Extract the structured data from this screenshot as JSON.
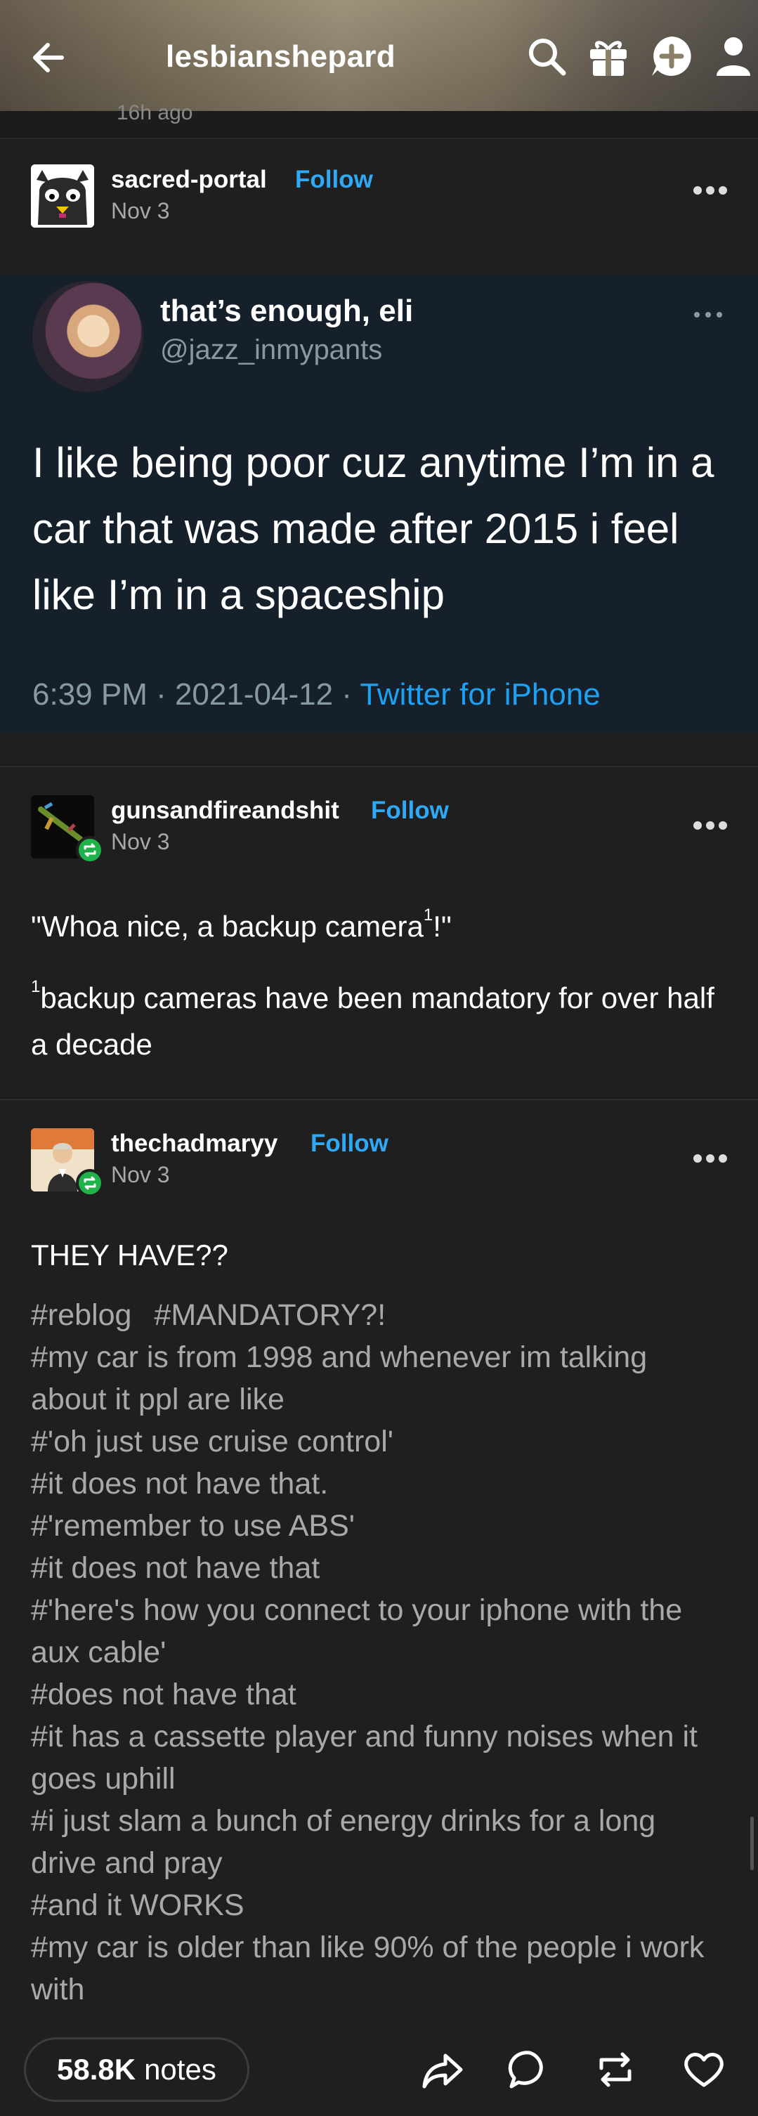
{
  "header": {
    "title": "lesbianshepard",
    "background_color": "#8c8068",
    "icons": [
      "back-arrow-icon",
      "search-icon",
      "gift-icon",
      "plus-bubble-icon",
      "user-icon"
    ]
  },
  "prev_post": {
    "partial_text": "16h ago"
  },
  "posts": [
    {
      "username": "sacred-portal",
      "follow_label": "Follow",
      "date": "Nov 3",
      "avatar_icon": "cartoon-penguin-avatar",
      "tweet": {
        "name": "that’s enough, eli",
        "handle": "@jazz_inmypants",
        "text": "I like being poor cuz anytime I’m in a car that was made after 2015 i feel like I’m in a spaceship",
        "time": "6:39 PM · 2021-04-12 · ",
        "source": "Twitter for iPhone",
        "background_color": "#15202b"
      }
    },
    {
      "username": "gunsandfireandshit",
      "follow_label": "Follow",
      "date": "Nov 3",
      "reblogged": true,
      "body_line1": "\"Whoa nice, a backup camera",
      "body_line1_sup": "1",
      "body_line1_end": "!\"",
      "body_line2_sup": "1",
      "body_line2": "backup cameras have been mandatory for over half a decade"
    },
    {
      "username": "thechadmaryy",
      "follow_label": "Follow",
      "date": "Nov 3",
      "reblogged": true,
      "body": "THEY HAVE??",
      "tags": [
        "#reblog",
        "#MANDATORY?!",
        "#my car is from 1998 and whenever im talking about it ppl are like",
        "#'oh just use cruise control'",
        "#it does not have that.",
        "#'remember to use ABS'",
        "#it does not have that",
        "#'here's how you connect to your iphone with the aux cable'",
        "#does not have that",
        "#it has a cassette player and funny noises when it goes uphill",
        "#i just slam a bunch of energy drinks for a long drive and pray",
        "#and it WORKS",
        "#my car is older than like 90% of the people i work with"
      ]
    }
  ],
  "footer": {
    "notes_count": "58.8K",
    "notes_label": "notes",
    "icons": [
      "share-icon",
      "comment-icon",
      "reblog-icon",
      "like-heart-icon"
    ]
  },
  "colors": {
    "follow_blue": "#2fa8f5",
    "reblog_green": "#20b24a",
    "twitter_blue": "#1da1f2"
  }
}
